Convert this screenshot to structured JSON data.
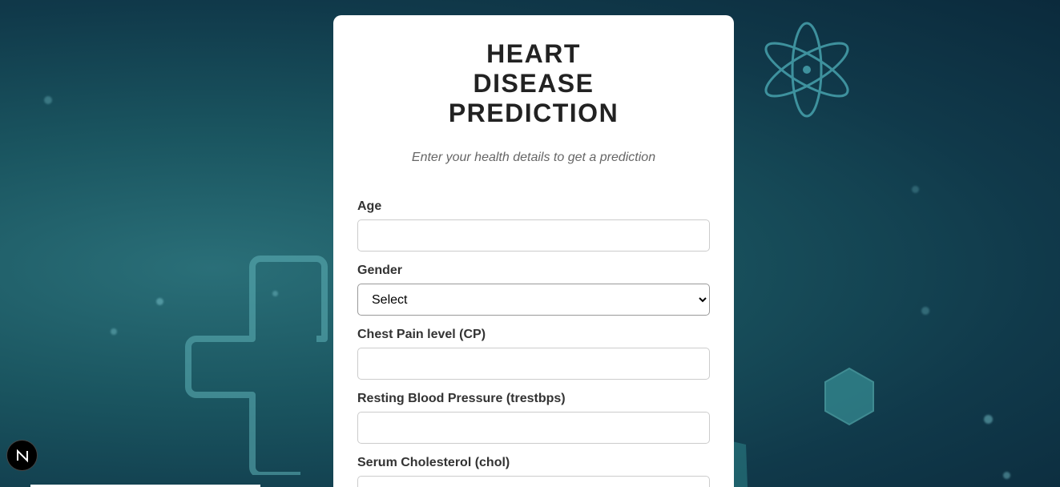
{
  "page": {
    "title": "HEART DISEASE PREDICTION",
    "subtitle": "Enter your health details to get a prediction"
  },
  "form": {
    "age": {
      "label": "Age",
      "value": "",
      "placeholder": ""
    },
    "gender": {
      "label": "Gender",
      "selected": "Select"
    },
    "chest_pain": {
      "label": "Chest Pain level (CP)",
      "value": "",
      "placeholder": ""
    },
    "resting_bp": {
      "label": "Resting Blood Pressure (trestbps)",
      "value": "",
      "placeholder": ""
    },
    "cholesterol": {
      "label": "Serum Cholesterol (chol)",
      "value": "",
      "placeholder": ""
    }
  },
  "badge": {
    "letter": "N",
    "icon": "nextjs-logo-icon"
  },
  "colors": {
    "background_dark": "#0b2a3c",
    "background_teal": "#2a6f78",
    "card": "#ffffff",
    "title": "#222222",
    "label": "#333333",
    "subtitle": "#666666"
  }
}
